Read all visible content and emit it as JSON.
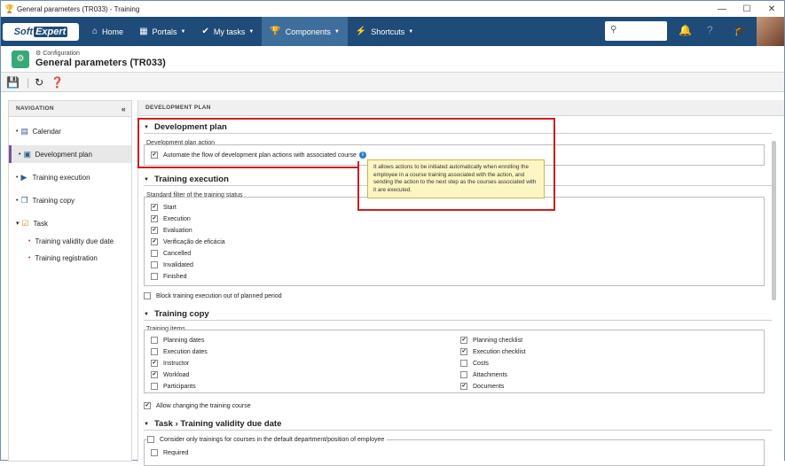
{
  "window": {
    "title": "General parameters (TR033) - Training",
    "min": "—",
    "max": "☐",
    "close": "✕"
  },
  "brand": {
    "part1": "Soft",
    "part2": "Expert"
  },
  "topnav": {
    "home": "Home",
    "portals": "Portals",
    "mytasks": "My tasks",
    "components": "Components",
    "shortcuts": "Shortcuts"
  },
  "breadcrumb": "Configuration",
  "page_title": "General parameters (TR033)",
  "navigation": {
    "header": "NAVIGATION",
    "items": [
      "Calendar",
      "Development plan",
      "Training execution",
      "Training copy",
      "Task"
    ],
    "subitems": [
      "Training validity due date",
      "Training registration"
    ]
  },
  "main_header": "DEVELOPMENT PLAN",
  "dev_plan": {
    "title": "Development plan",
    "group": "Development plan action",
    "automate_label": "Automate the flow of development plan actions with associated course",
    "tooltip": "It allows actions to be initiated automatically when enrolling the employee in a course training associated with the action, and sending the action to the next step as the courses associated with it are executed."
  },
  "training_execution": {
    "title": "Training execution",
    "group": "Standard filter of the training status",
    "statuses": [
      {
        "label": "Start",
        "checked": true
      },
      {
        "label": "Execution",
        "checked": true
      },
      {
        "label": "Evaluation",
        "checked": true
      },
      {
        "label": "Verificação de eficácia",
        "checked": true
      },
      {
        "label": "Cancelled",
        "checked": false
      },
      {
        "label": "Invalidated",
        "checked": false
      },
      {
        "label": "Finished",
        "checked": false
      }
    ],
    "block_label": "Block training execution out of planned period"
  },
  "training_copy": {
    "title": "Training copy",
    "group": "Training items",
    "left": [
      {
        "label": "Planning dates",
        "checked": false
      },
      {
        "label": "Execution dates",
        "checked": false
      },
      {
        "label": "Instructor",
        "checked": true
      },
      {
        "label": "Workload",
        "checked": true
      },
      {
        "label": "Participants",
        "checked": false
      }
    ],
    "right": [
      {
        "label": "Planning checklist",
        "checked": true
      },
      {
        "label": "Execution checklist",
        "checked": true
      },
      {
        "label": "Costs",
        "checked": false
      },
      {
        "label": "Attachments",
        "checked": false
      },
      {
        "label": "Documents",
        "checked": true
      }
    ],
    "allow_label": "Allow changing the training course"
  },
  "task_validity": {
    "title_part1": "Task",
    "title_sep": "›",
    "title_part2": "Training validity due date",
    "consider_label": "Consider only trainings for courses in the default department/position of employee",
    "required_label": "Required"
  }
}
